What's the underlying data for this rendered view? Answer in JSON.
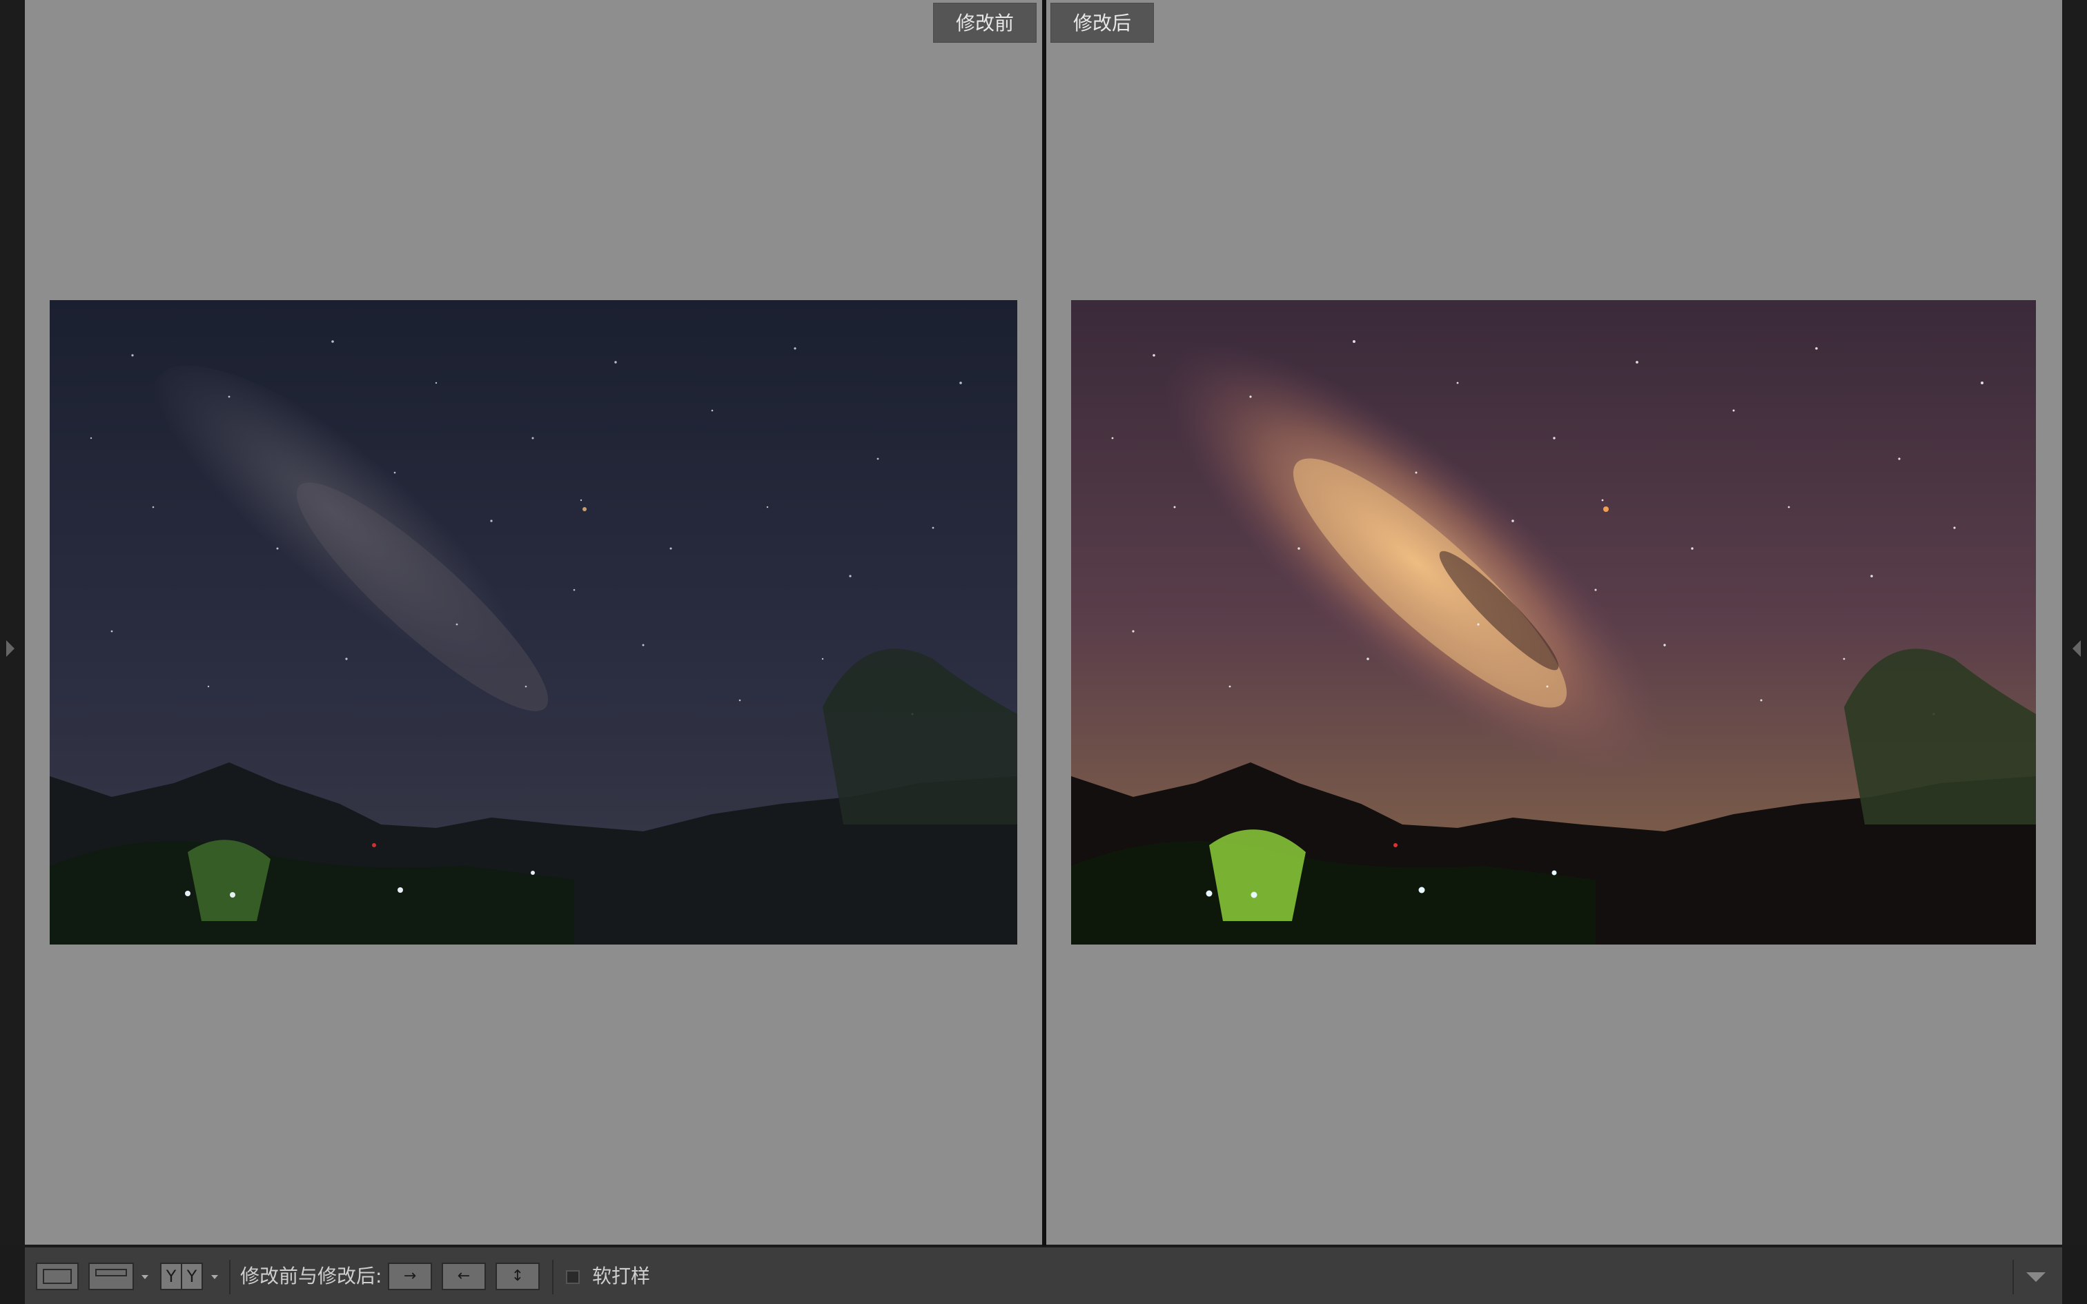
{
  "panels": {
    "before_label": "修改前",
    "after_label": "修改后"
  },
  "toolbar": {
    "view_single_icon": "loupe-view-icon",
    "view_split_icon": "before-after-split-icon",
    "yy_left": "Y",
    "yy_right": "Y",
    "compare_label": "修改前与修改后:",
    "copy_before_to_after_icon": "copy-right-arrow-icon",
    "copy_after_to_before_icon": "copy-left-arrow-icon",
    "swap_icon": "swap-arrows-icon",
    "soft_proof_label": "软打样",
    "soft_proof_checked": false
  },
  "colors": {
    "workspace_bg": "#8e8e8e",
    "toolbar_bg": "#3d3d3d",
    "tag_bg": "#555555"
  }
}
